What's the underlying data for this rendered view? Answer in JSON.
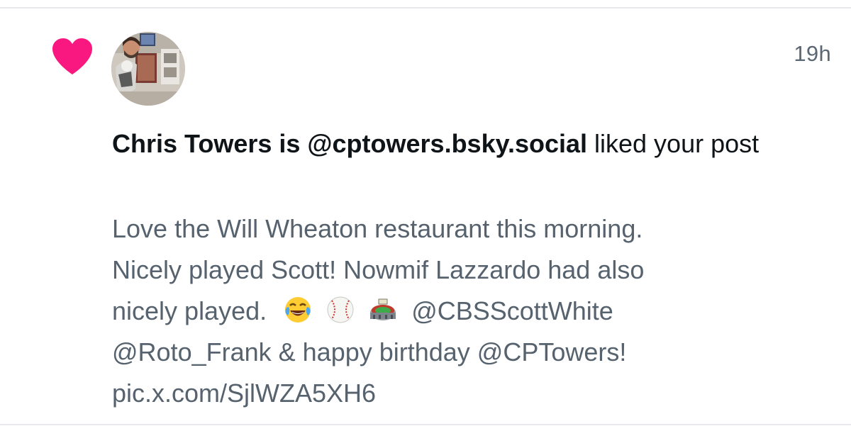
{
  "notification": {
    "timestamp": "19h",
    "actor_name": "Chris Towers is @cptowers.bsky.social",
    "action_text": " liked your post",
    "post": {
      "line1": "Love the Will Wheaton restaurant this morning.",
      "line2": "Nicely played Scott! Nowmif Lazzardo had also",
      "line3_start": "nicely played.",
      "emojis": [
        "face-with-tears-of-joy",
        "baseball",
        "stadium"
      ],
      "line3_mention": "@CBSScottWhite",
      "line4": "@Roto_Frank & happy birthday @CPTowers!",
      "line5": "pic.x.com/SjlWZA5XH6"
    }
  },
  "colors": {
    "heart": "#f91880",
    "primary_text": "#0f1419",
    "secondary_text": "#56626d",
    "divider": "#e7e9ec"
  },
  "icons": {
    "like": "heart-icon",
    "avatar": "user-avatar"
  }
}
